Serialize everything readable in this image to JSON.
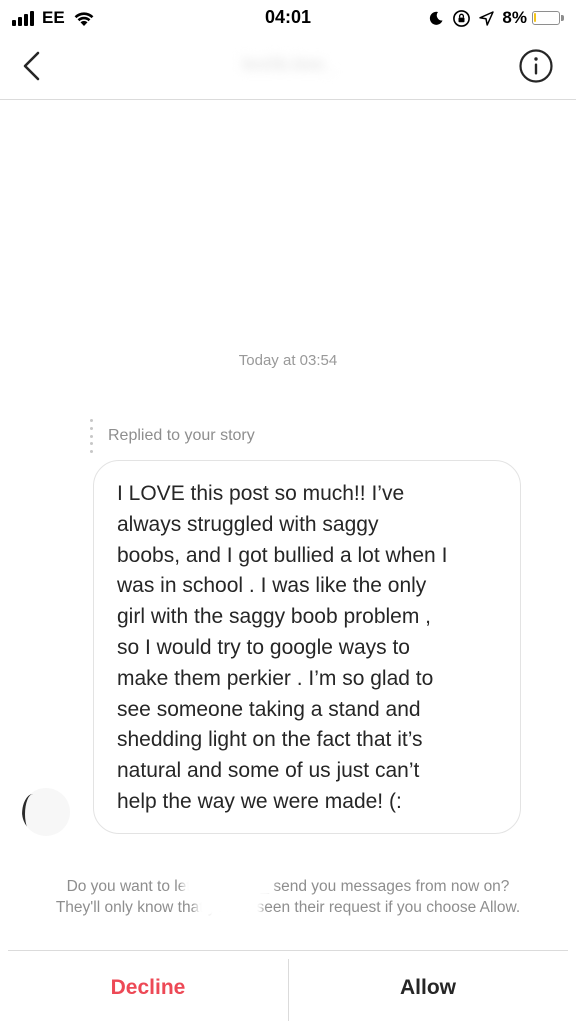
{
  "status_bar": {
    "carrier": "EE",
    "time": "04:01",
    "battery_percent": "8%",
    "battery_level": 0.08,
    "battery_color": "#f5c518",
    "icons": [
      "signal-icon",
      "wifi-icon",
      "do-not-disturb-icon",
      "rotation-lock-icon",
      "location-icon",
      "battery-icon"
    ]
  },
  "nav": {
    "title": "lexiib.bee_",
    "back_icon": "chevron-left-icon",
    "info_icon": "info-icon"
  },
  "conversation": {
    "timestamp": "Today at 03:54",
    "reply_label": "Replied to your story",
    "message": "I LOVE this post so much!! I’ve\nalways struggled with saggy\nboobs, and I got bullied a lot when I\nwas in school . I was like the only\ngirl with the saggy boob problem ,\nso I would try to google ways to\nmake them perkier . I’m so glad to\nsee someone taking a stand and\nshedding light on the fact that it’s\nnatural and some of us just can’t\nhelp the way we were made! (:"
  },
  "request": {
    "prompt": "Do you want to let lexiib.bee_ send you messages from now on?\nThey'll only know that you've seen their request if you choose Allow.",
    "decline_label": "Decline",
    "allow_label": "Allow",
    "decline_color": "#ed4956"
  }
}
